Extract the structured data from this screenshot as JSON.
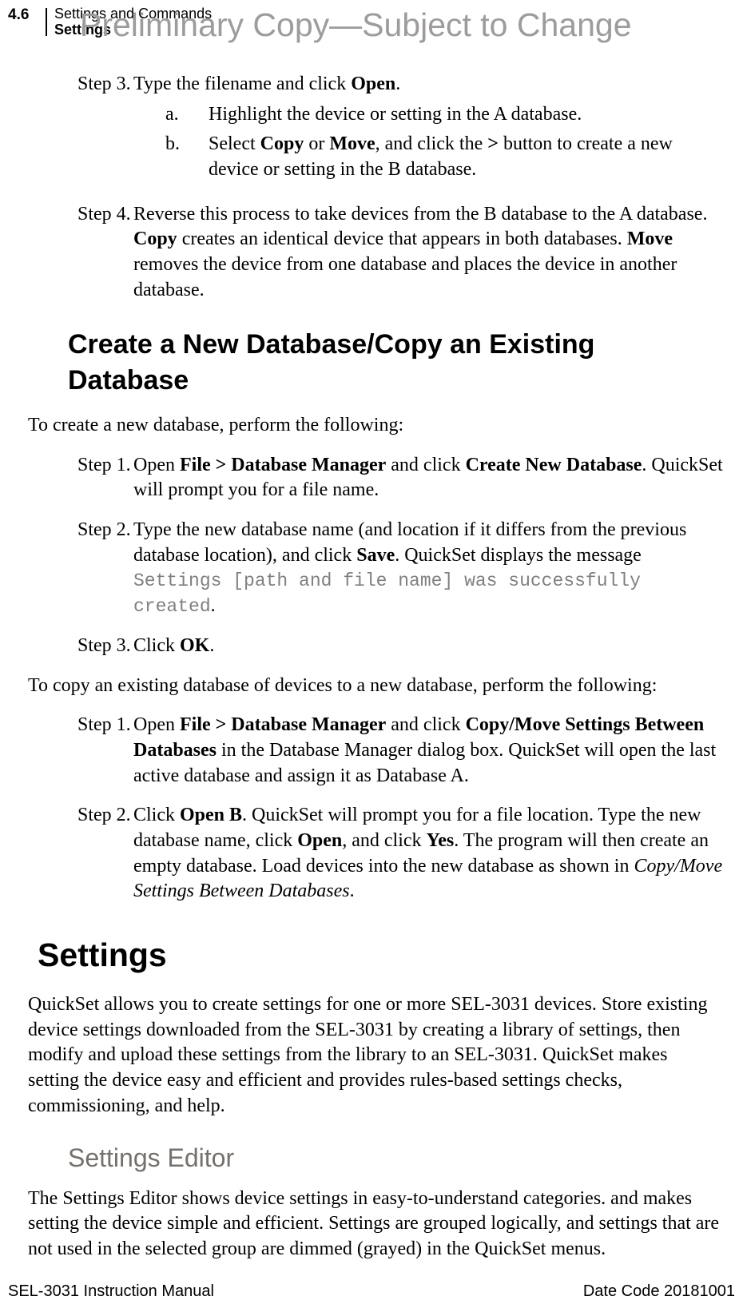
{
  "header": {
    "page_number": "4.6",
    "title1": "Settings and Commands",
    "title2": "Settings"
  },
  "watermark": "Preliminary Copy—Subject to Change",
  "steps_top": {
    "step3": {
      "label": "Step 3.",
      "text_pre": "Type the filename and click ",
      "open": "Open",
      "text_post": ".",
      "a": {
        "letter": "a.",
        "text": "Highlight the device or setting in the A database."
      },
      "b": {
        "letter": "b.",
        "pre": "Select ",
        "copy": "Copy",
        "or": " or ",
        "move": "Move",
        "mid": ", and click the ",
        "gt": ">",
        "post": " button to create a new device or setting in the B database."
      }
    },
    "step4": {
      "label": "Step 4.",
      "pre": "Reverse this process to take devices from the B database to the A database. ",
      "copy": "Copy",
      "mid1": " creates an identical device that appears in both databases. ",
      "move": "Move",
      "post": " removes the device from one database and places the device in another database."
    }
  },
  "h2_create": "Create a New Database/Copy an Existing Database",
  "para_create_intro": "To create a new database, perform the following:",
  "create_steps": {
    "s1": {
      "label": "Step 1.",
      "pre": "Open ",
      "file": "File > Database Manager",
      "mid": " and click ",
      "cnd": "Create New Database",
      "post": ". QuickSet will prompt you for a file name."
    },
    "s2": {
      "label": "Step 2.",
      "pre": "Type the new database name (and location if it differs from the previous database location), and click ",
      "save": "Save",
      "mid": ". QuickSet displays the message ",
      "code": "Settings [path and file name] was successfully created",
      "post": "."
    },
    "s3": {
      "label": "Step 3.",
      "pre": "Click ",
      "ok": "OK",
      "post": "."
    }
  },
  "para_copy_intro": "To copy an existing database of devices to a new database, perform the following:",
  "copy_steps": {
    "s1": {
      "label": "Step 1.",
      "pre": "Open ",
      "file": "File > Database Manager",
      "mid": " and click ",
      "cm": "Copy/Move Settings Between Databases",
      "post": " in the Database Manager dialog box. QuickSet will open the last active database and assign it as Database A."
    },
    "s2": {
      "label": "Step 2.",
      "pre": "Click ",
      "openb": "Open B",
      "mid1": ". QuickSet will prompt you for a file location. Type the new database name, click ",
      "open": "Open",
      "mid2": ", and click ",
      "yes": "Yes",
      "mid3": ". The program will then create an empty database. Load devices into the new database as shown in ",
      "italic": "Copy/Move Settings Between Databases",
      "post": "."
    }
  },
  "h1_settings": "Settings",
  "para_settings": "QuickSet allows you to create settings for one or more SEL-3031 devices. Store existing device settings downloaded from the SEL-3031 by creating a library of settings, then modify and upload these settings from the library to an SEL-3031. QuickSet makes setting the device easy and efficient and provides rules-based settings checks, commissioning, and help.",
  "h3_editor": "Settings Editor",
  "para_editor": "The Settings Editor shows device settings in easy-to-understand categories. and makes setting the device simple and efficient. Settings are grouped logically, and settings that are not used in the selected group are dimmed (grayed) in the QuickSet menus.",
  "footer": {
    "left": "SEL-3031 Instruction Manual",
    "right": "Date Code 20181001"
  }
}
